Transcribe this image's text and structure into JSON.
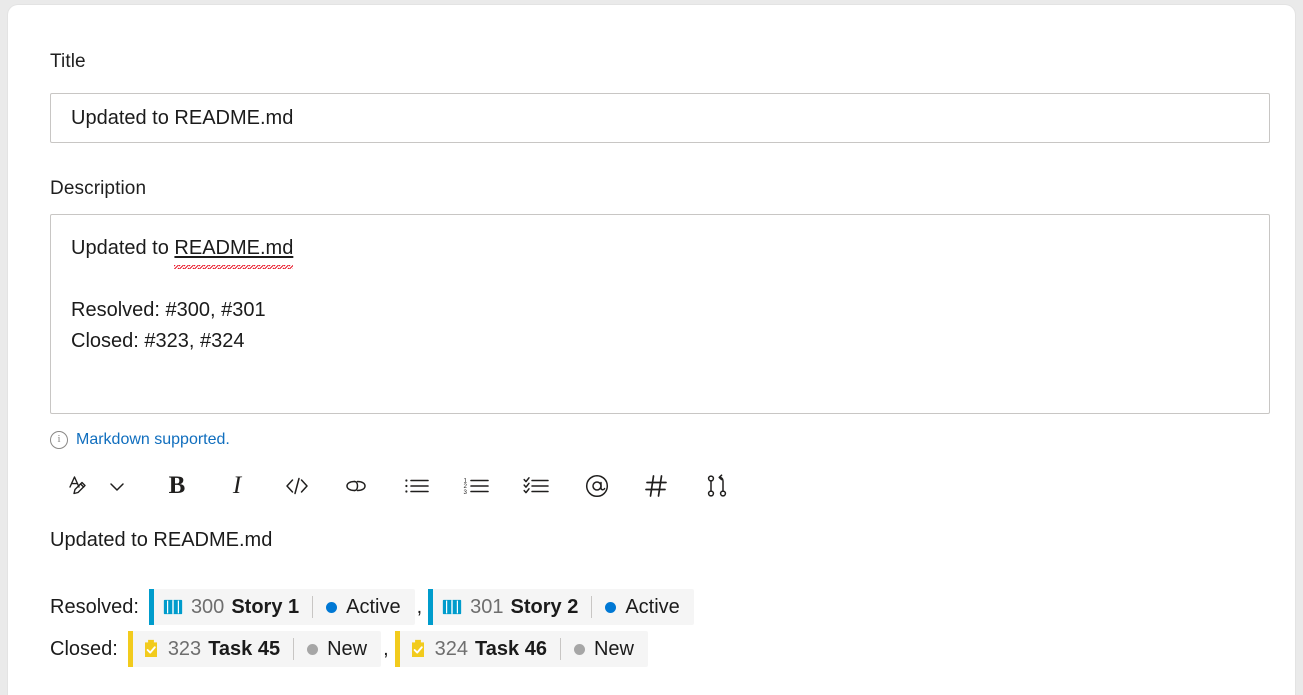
{
  "form": {
    "title_label": "Title",
    "title_value": "Updated to README.md",
    "description_label": "Description",
    "description_line1_prefix": "Updated to ",
    "description_line1_word": "README.md",
    "description_rest": "\n\nResolved: #300, #301\nClosed: #323, #324"
  },
  "markdown_note": {
    "icon": "info-circle-icon",
    "text": "Markdown supported.",
    "link_color": "#106ebe"
  },
  "toolbar": {
    "items": [
      {
        "name": "text-style-icon",
        "label": "Text style"
      },
      {
        "name": "chevron-down-icon",
        "label": "More text styles"
      },
      {
        "name": "bold-icon",
        "label": "B"
      },
      {
        "name": "italic-icon",
        "label": "I"
      },
      {
        "name": "code-icon",
        "label": "</>"
      },
      {
        "name": "link-icon",
        "label": "Link"
      },
      {
        "name": "bulleted-list-icon",
        "label": "Bulleted list"
      },
      {
        "name": "numbered-list-icon",
        "label": "Numbered list"
      },
      {
        "name": "checklist-icon",
        "label": "Checklist"
      },
      {
        "name": "mention-icon",
        "label": "@"
      },
      {
        "name": "hashtag-icon",
        "label": "#"
      },
      {
        "name": "pull-request-icon",
        "label": "Pull request"
      }
    ]
  },
  "preview": {
    "heading": "Updated to README.md",
    "rows": [
      {
        "label": "Resolved:",
        "chips": [
          {
            "id": "300",
            "title": "Story 1",
            "state": "Active",
            "type_icon": "story-book-icon",
            "accent": "#009ccc",
            "state_color": "#0078d4"
          },
          {
            "id": "301",
            "title": "Story 2",
            "state": "Active",
            "type_icon": "story-book-icon",
            "accent": "#009ccc",
            "state_color": "#0078d4"
          }
        ],
        "separator": ","
      },
      {
        "label": "Closed:",
        "chips": [
          {
            "id": "323",
            "title": "Task 45",
            "state": "New",
            "type_icon": "task-clipboard-icon",
            "accent": "#f2cb1d",
            "state_color": "#a6a6a6"
          },
          {
            "id": "324",
            "title": "Task 46",
            "state": "New",
            "type_icon": "task-clipboard-icon",
            "accent": "#f2cb1d",
            "state_color": "#a6a6a6"
          }
        ],
        "separator": ","
      }
    ]
  }
}
